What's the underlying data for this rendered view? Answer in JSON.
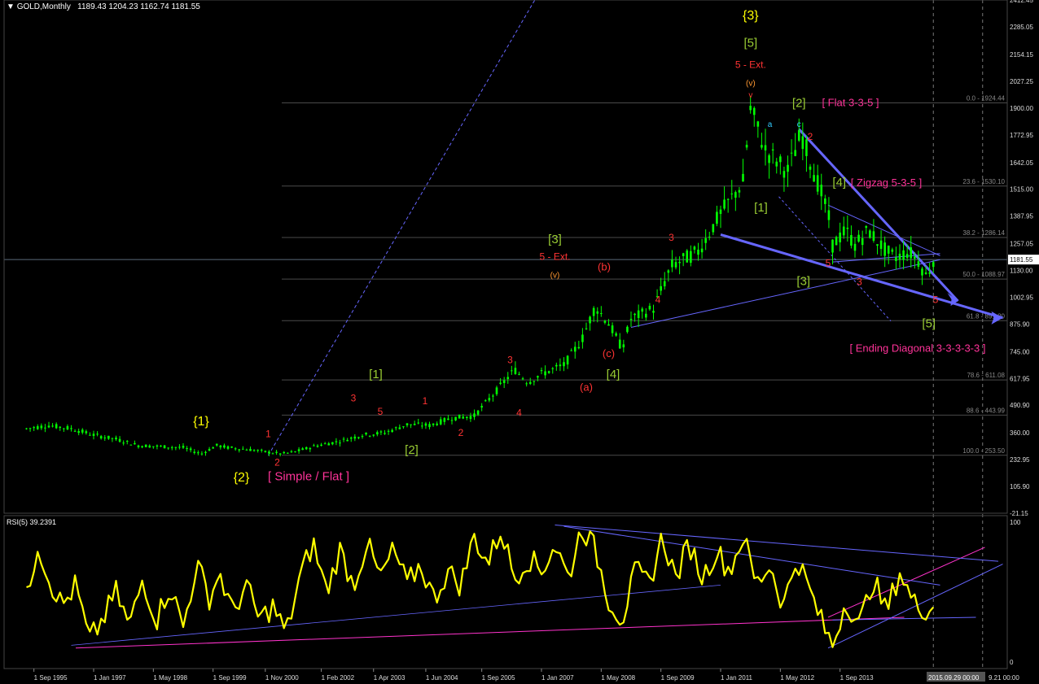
{
  "header": {
    "symbol": "GOLD,Monthly",
    "ohlc": "1189.43 1204.23 1162.74 1181.55",
    "rsi_label": "RSI(5) 39.2391"
  },
  "colors": {
    "background": "#000000",
    "candle": "#00ff00",
    "rsi_line": "#ffff00",
    "fib_line": "#4a4a4a",
    "trend_line": "#6666ff",
    "magenta_line": "#ff33cc",
    "wave_yellow": "#ffff00",
    "wave_green": "#99cc33",
    "wave_red": "#ff3333",
    "wave_orange": "#ff9933",
    "wave_cyan": "#33ccff",
    "label_magenta": "#ff3399"
  },
  "chart_data": {
    "type": "candlestick",
    "y_ticks": [
      "2412.45",
      "2285.05",
      "2154.15",
      "2027.25",
      "1900.00",
      "1772.95",
      "1642.05",
      "1515.00",
      "1387.95",
      "1257.05",
      "1181.55",
      "1130.00",
      "1002.95",
      "875.90",
      "745.00",
      "617.95",
      "490.90",
      "360.00",
      "232.95",
      "105.90",
      "-21.15"
    ],
    "x_ticks": [
      "1 Sep 1995",
      "1 Jan 1997",
      "1 May 1998",
      "1 Sep 1999",
      "1 Nov 2000",
      "1 Feb 2002",
      "1 Apr 2003",
      "1 Jun 2004",
      "1 Sep 2005",
      "1 Jan 2007",
      "1 May 2008",
      "1 Sep 2009",
      "1 Jan 2011",
      "1 May 2012",
      "1 Sep 2013"
    ],
    "x_ticks_highlight": "2015.09.29 00:00",
    "x_ticks_last": "9.21 00:00",
    "current_price": "1181.55",
    "fib_levels": [
      {
        "label": "0.0 - 1924.44",
        "value": 1924.44
      },
      {
        "label": "23.6 - 1530.10",
        "value": 1530.1
      },
      {
        "label": "38.2 - 1286.14",
        "value": 1286.14
      },
      {
        "label": "50.0 - 1088.97",
        "value": 1088.97
      },
      {
        "label": "61.8 - 891.80",
        "value": 891.8
      },
      {
        "label": "78.6 - 611.08",
        "value": 611.08
      },
      {
        "label": "88.6 - 443.99",
        "value": 443.99
      },
      {
        "label": "100.0 - 253.50",
        "value": 253.5
      }
    ],
    "price_path": [
      [
        1995.5,
        380
      ],
      [
        1996.0,
        395
      ],
      [
        1996.5,
        380
      ],
      [
        1997.0,
        350
      ],
      [
        1997.5,
        330
      ],
      [
        1998.0,
        300
      ],
      [
        1998.5,
        295
      ],
      [
        1999.0,
        290
      ],
      [
        1999.4,
        260
      ],
      [
        1999.75,
        300
      ],
      [
        2000.0,
        290
      ],
      [
        2000.5,
        280
      ],
      [
        2001.0,
        265
      ],
      [
        2001.2,
        260
      ],
      [
        2001.5,
        270
      ],
      [
        2002.0,
        300
      ],
      [
        2002.5,
        320
      ],
      [
        2003.0,
        350
      ],
      [
        2003.5,
        360
      ],
      [
        2004.0,
        400
      ],
      [
        2004.5,
        395
      ],
      [
        2005.0,
        430
      ],
      [
        2005.5,
        440
      ],
      [
        2006.0,
        560
      ],
      [
        2006.4,
        660
      ],
      [
        2006.7,
        600
      ],
      [
        2007.0,
        640
      ],
      [
        2007.5,
        680
      ],
      [
        2007.9,
        800
      ],
      [
        2008.2,
        960
      ],
      [
        2008.5,
        880
      ],
      [
        2008.8,
        760
      ],
      [
        2009.0,
        900
      ],
      [
        2009.5,
        950
      ],
      [
        2009.9,
        1150
      ],
      [
        2010.5,
        1220
      ],
      [
        2011.0,
        1400
      ],
      [
        2011.5,
        1550
      ],
      [
        2011.67,
        1900
      ],
      [
        2012.0,
        1700
      ],
      [
        2012.5,
        1600
      ],
      [
        2012.8,
        1780
      ],
      [
        2013.0,
        1650
      ],
      [
        2013.4,
        1400
      ],
      [
        2013.5,
        1250
      ],
      [
        2013.8,
        1320
      ],
      [
        2014.0,
        1250
      ],
      [
        2014.3,
        1320
      ],
      [
        2014.7,
        1220
      ],
      [
        2014.9,
        1190
      ],
      [
        2015.2,
        1220
      ],
      [
        2015.4,
        1180
      ],
      [
        2015.6,
        1100
      ],
      [
        2015.75,
        1181
      ]
    ],
    "rsi_range": [
      0,
      100
    ],
    "rsi_ticks": [
      "100",
      "0"
    ],
    "rsi_path": [
      [
        1995.5,
        45
      ],
      [
        1995.75,
        85
      ],
      [
        1996.0,
        60
      ],
      [
        1996.3,
        40
      ],
      [
        1996.6,
        55
      ],
      [
        1996.9,
        15
      ],
      [
        1997.2,
        30
      ],
      [
        1997.5,
        50
      ],
      [
        1997.8,
        25
      ],
      [
        1998.1,
        60
      ],
      [
        1998.4,
        30
      ],
      [
        1998.7,
        55
      ],
      [
        1999.0,
        25
      ],
      [
        1999.3,
        70
      ],
      [
        1999.6,
        45
      ],
      [
        1999.8,
        65
      ],
      [
        2000.1,
        35
      ],
      [
        2000.4,
        55
      ],
      [
        2000.7,
        30
      ],
      [
        2001.0,
        40
      ],
      [
        2001.3,
        20
      ],
      [
        2001.6,
        60
      ],
      [
        2001.9,
        85
      ],
      [
        2002.2,
        50
      ],
      [
        2002.5,
        80
      ],
      [
        2002.8,
        55
      ],
      [
        2003.1,
        85
      ],
      [
        2003.4,
        60
      ],
      [
        2003.7,
        80
      ],
      [
        2004.0,
        55
      ],
      [
        2004.3,
        70
      ],
      [
        2004.6,
        45
      ],
      [
        2004.9,
        65
      ],
      [
        2005.2,
        55
      ],
      [
        2005.5,
        90
      ],
      [
        2005.8,
        70
      ],
      [
        2006.1,
        95
      ],
      [
        2006.4,
        60
      ],
      [
        2006.7,
        75
      ],
      [
        2007.0,
        65
      ],
      [
        2007.3,
        85
      ],
      [
        2007.6,
        60
      ],
      [
        2007.9,
        97
      ],
      [
        2008.2,
        80
      ],
      [
        2008.5,
        45
      ],
      [
        2008.8,
        30
      ],
      [
        2009.1,
        65
      ],
      [
        2009.4,
        55
      ],
      [
        2009.7,
        90
      ],
      [
        2010.0,
        60
      ],
      [
        2010.3,
        85
      ],
      [
        2010.6,
        60
      ],
      [
        2010.9,
        80
      ],
      [
        2011.2,
        65
      ],
      [
        2011.5,
        90
      ],
      [
        2011.8,
        55
      ],
      [
        2012.1,
        70
      ],
      [
        2012.4,
        40
      ],
      [
        2012.7,
        75
      ],
      [
        2013.0,
        50
      ],
      [
        2013.3,
        25
      ],
      [
        2013.5,
        12
      ],
      [
        2013.8,
        45
      ],
      [
        2014.1,
        25
      ],
      [
        2014.4,
        60
      ],
      [
        2014.7,
        35
      ],
      [
        2015.0,
        65
      ],
      [
        2015.3,
        42
      ],
      [
        2015.6,
        38
      ],
      [
        2015.75,
        39
      ]
    ],
    "annotations": [
      {
        "text": "{3}",
        "x": 2011.67,
        "y": 2320,
        "color": "wave_yellow",
        "size": 16
      },
      {
        "text": "[5]",
        "x": 2011.67,
        "y": 2190,
        "color": "wave_green",
        "size": 15
      },
      {
        "text": "5 - Ext.",
        "x": 2011.67,
        "y": 2090,
        "color": "wave_red",
        "size": 12
      },
      {
        "text": "(v)",
        "x": 2011.67,
        "y": 2005,
        "color": "wave_orange",
        "size": 10
      },
      {
        "text": "v",
        "x": 2011.67,
        "y": 1950,
        "color": "wave_red",
        "size": 10
      },
      {
        "text": "[2]",
        "x": 2012.75,
        "y": 1905,
        "color": "wave_green",
        "size": 15
      },
      {
        "text": "[ Flat 3-3-5 ]",
        "x": 2013.9,
        "y": 1910,
        "color": "label_magenta",
        "size": 13
      },
      {
        "text": "c",
        "x": 2012.75,
        "y": 1810,
        "color": "wave_cyan",
        "size": 10
      },
      {
        "text": "2",
        "x": 2013.0,
        "y": 1750,
        "color": "wave_red",
        "size": 12
      },
      {
        "text": "a",
        "x": 2012.1,
        "y": 1810,
        "color": "wave_cyan",
        "size": 10
      },
      {
        "text": "[4]",
        "x": 2013.65,
        "y": 1530,
        "color": "wave_green",
        "size": 15
      },
      {
        "text": "[ Zigzag 5-3-5 ]",
        "x": 2014.7,
        "y": 1530,
        "color": "label_magenta",
        "size": 13
      },
      {
        "text": "[1]",
        "x": 2011.9,
        "y": 1410,
        "color": "wave_green",
        "size": 15
      },
      {
        "text": "[3]",
        "x": 2012.85,
        "y": 1060,
        "color": "wave_green",
        "size": 15
      },
      {
        "text": "[5]",
        "x": 2015.65,
        "y": 860,
        "color": "wave_green",
        "size": 15
      },
      {
        "text": "[ Ending Diagonal 3-3-3-3-3 ]",
        "x": 2015.4,
        "y": 745,
        "color": "label_magenta",
        "size": 13
      },
      {
        "text": "[3]",
        "x": 2007.3,
        "y": 1260,
        "color": "wave_green",
        "size": 15
      },
      {
        "text": "5 - Ext.",
        "x": 2007.3,
        "y": 1180,
        "color": "wave_red",
        "size": 12
      },
      {
        "text": "(v)",
        "x": 2007.3,
        "y": 1095,
        "color": "wave_orange",
        "size": 10
      },
      {
        "text": "(b)",
        "x": 2008.4,
        "y": 1130,
        "color": "wave_red",
        "size": 13
      },
      {
        "text": "(a)",
        "x": 2008.0,
        "y": 560,
        "color": "wave_red",
        "size": 13
      },
      {
        "text": "(c)",
        "x": 2008.5,
        "y": 720,
        "color": "wave_red",
        "size": 13
      },
      {
        "text": "[4]",
        "x": 2008.6,
        "y": 620,
        "color": "wave_green",
        "size": 15
      },
      {
        "text": "[1]",
        "x": 2003.3,
        "y": 620,
        "color": "wave_green",
        "size": 15
      },
      {
        "text": "[2]",
        "x": 2004.1,
        "y": 260,
        "color": "wave_green",
        "size": 15
      },
      {
        "text": "{1}",
        "x": 1999.4,
        "y": 395,
        "color": "wave_yellow",
        "size": 16
      },
      {
        "text": "{2}",
        "x": 2000.3,
        "y": 130,
        "color": "wave_yellow",
        "size": 16
      },
      {
        "text": "[ Simple / Flat ]",
        "x": 2001.8,
        "y": 135,
        "color": "label_magenta",
        "size": 15
      },
      {
        "text": "3",
        "x": 2002.8,
        "y": 510,
        "color": "wave_red",
        "size": 12
      },
      {
        "text": "5",
        "x": 2003.4,
        "y": 445,
        "color": "wave_red",
        "size": 12
      },
      {
        "text": "1",
        "x": 2004.4,
        "y": 495,
        "color": "wave_red",
        "size": 12
      },
      {
        "text": "2",
        "x": 2005.2,
        "y": 345,
        "color": "wave_red",
        "size": 12
      },
      {
        "text": "3",
        "x": 2006.3,
        "y": 690,
        "color": "wave_red",
        "size": 12
      },
      {
        "text": "4",
        "x": 2006.5,
        "y": 440,
        "color": "wave_red",
        "size": 12
      },
      {
        "text": "1",
        "x": 2000.9,
        "y": 340,
        "color": "wave_red",
        "size": 12
      },
      {
        "text": "2",
        "x": 2001.1,
        "y": 205,
        "color": "wave_red",
        "size": 12
      },
      {
        "text": "3",
        "x": 2009.9,
        "y": 1270,
        "color": "wave_red",
        "size": 12
      },
      {
        "text": "4",
        "x": 2009.6,
        "y": 975,
        "color": "wave_red",
        "size": 12
      },
      {
        "text": "3",
        "x": 2014.1,
        "y": 1060,
        "color": "wave_red",
        "size": 12
      },
      {
        "text": "5",
        "x": 2013.4,
        "y": 1150,
        "color": "wave_red",
        "size": 12
      },
      {
        "text": "5",
        "x": 2015.8,
        "y": 975,
        "color": "wave_red",
        "size": 12
      }
    ]
  }
}
